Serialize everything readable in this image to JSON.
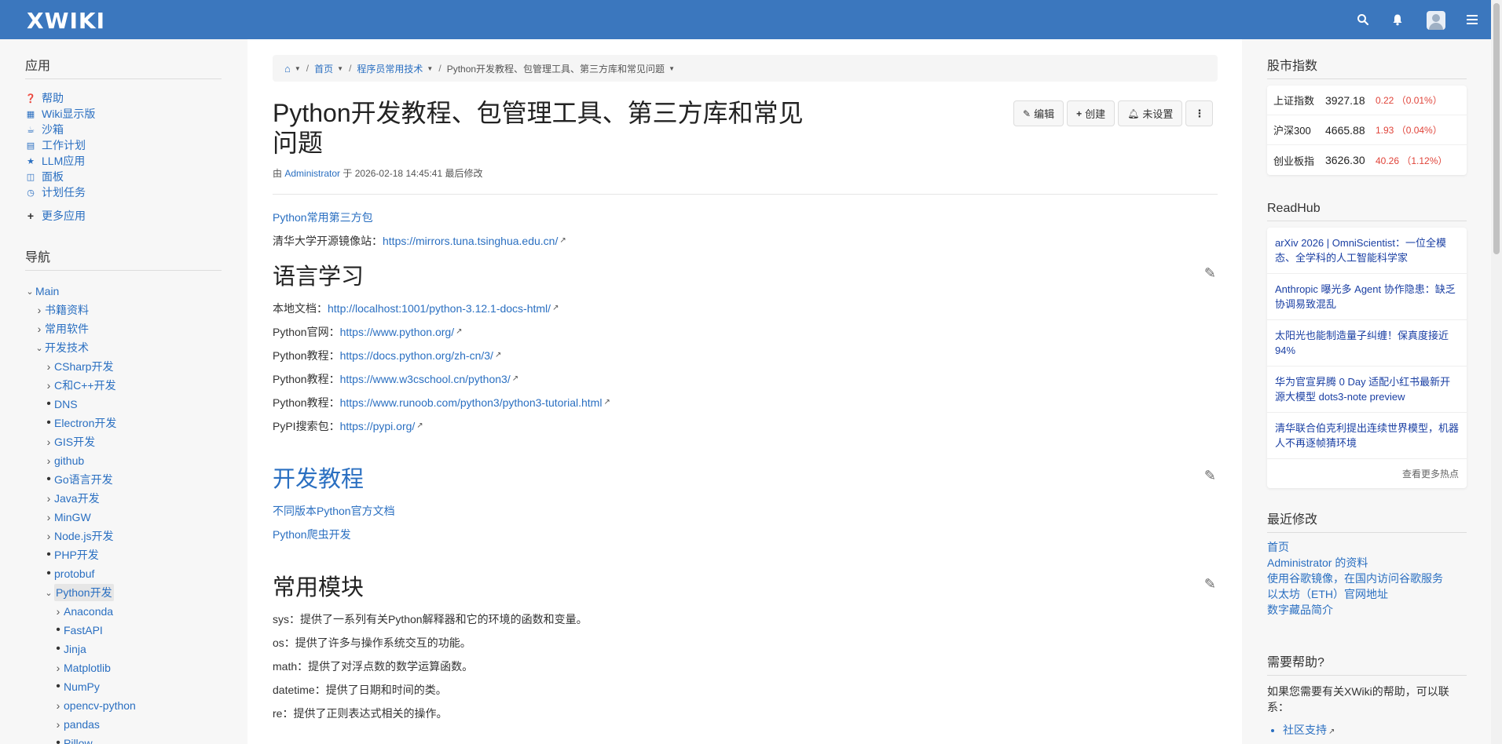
{
  "topbar": {
    "logo": "XWIKI"
  },
  "apps": {
    "title": "应用",
    "items": [
      {
        "label": "帮助",
        "icon": "question-circle-icon"
      },
      {
        "label": "Wiki显示版",
        "icon": "grid-icon"
      },
      {
        "label": "沙箱",
        "icon": "coffee-icon"
      },
      {
        "label": "工作计划",
        "icon": "calendar-icon"
      },
      {
        "label": "LLM应用",
        "icon": "star-icon"
      },
      {
        "label": "面板",
        "icon": "panel-icon"
      },
      {
        "label": "计划任务",
        "icon": "clock-icon"
      }
    ],
    "more": "更多应用"
  },
  "navigation": {
    "title": "导航",
    "items": [
      {
        "label": "Main",
        "level": 0,
        "marker": "open"
      },
      {
        "label": "书籍资料",
        "level": 1,
        "marker": "closed"
      },
      {
        "label": "常用软件",
        "level": 1,
        "marker": "closed"
      },
      {
        "label": "开发技术",
        "level": 1,
        "marker": "open"
      },
      {
        "label": "CSharp开发",
        "level": 2,
        "marker": "closed"
      },
      {
        "label": "C和C++开发",
        "level": 2,
        "marker": "closed"
      },
      {
        "label": "DNS",
        "level": 2,
        "marker": "leaf"
      },
      {
        "label": "Electron开发",
        "level": 2,
        "marker": "leaf"
      },
      {
        "label": "GIS开发",
        "level": 2,
        "marker": "closed"
      },
      {
        "label": "github",
        "level": 2,
        "marker": "closed"
      },
      {
        "label": "Go语言开发",
        "level": 2,
        "marker": "leaf"
      },
      {
        "label": "Java开发",
        "level": 2,
        "marker": "closed"
      },
      {
        "label": "MinGW",
        "level": 2,
        "marker": "closed"
      },
      {
        "label": "Node.js开发",
        "level": 2,
        "marker": "closed"
      },
      {
        "label": "PHP开发",
        "level": 2,
        "marker": "leaf"
      },
      {
        "label": "protobuf",
        "level": 2,
        "marker": "leaf"
      },
      {
        "label": "Python开发",
        "level": 2,
        "marker": "open",
        "active": true
      },
      {
        "label": "Anaconda",
        "level": 3,
        "marker": "closed"
      },
      {
        "label": "FastAPI",
        "level": 3,
        "marker": "leaf"
      },
      {
        "label": "Jinja",
        "level": 3,
        "marker": "leaf"
      },
      {
        "label": "Matplotlib",
        "level": 3,
        "marker": "closed"
      },
      {
        "label": "NumPy",
        "level": 3,
        "marker": "leaf"
      },
      {
        "label": "opencv-python",
        "level": 3,
        "marker": "closed"
      },
      {
        "label": "pandas",
        "level": 3,
        "marker": "closed"
      },
      {
        "label": "Pillow",
        "level": 3,
        "marker": "leaf"
      }
    ]
  },
  "breadcrumb": {
    "items": [
      "首页",
      "程序员常用技术",
      "Python开发教程、包管理工具、第三方库和常见问题"
    ]
  },
  "page": {
    "title": "Python开发教程、包管理工具、第三方库和常见问题",
    "meta_prefix": "由",
    "author": "Administrator",
    "meta_suffix": "于 2026-02-18 14:45:41 最后修改",
    "actions": [
      {
        "label": "编辑",
        "icon": "pencil-icon"
      },
      {
        "label": "创建",
        "icon": "plus-icon"
      },
      {
        "label": "未设置",
        "icon": "bell-icon"
      }
    ]
  },
  "content": {
    "intro_link": "Python常用第三方包",
    "mirror_label": "清华大学开源镜像站：",
    "mirror_url": "https://mirrors.tuna.tsinghua.edu.cn/",
    "sections": [
      {
        "heading": "语言学习",
        "linked": false,
        "lines": [
          {
            "label": "本地文档：",
            "url": "http://localhost:1001/python-3.12.1-docs-html/"
          },
          {
            "label": "Python官网：",
            "url": "https://www.python.org/"
          },
          {
            "label": "Python教程：",
            "url": "https://docs.python.org/zh-cn/3/"
          },
          {
            "label": "Python教程：",
            "url": "https://www.w3cschool.cn/python3/"
          },
          {
            "label": "Python教程：",
            "url": "https://www.runoob.com/python3/python3-tutorial.html"
          },
          {
            "label": "PyPI搜索包：",
            "url": "https://pypi.org/"
          }
        ]
      },
      {
        "heading": "开发教程",
        "linked": true,
        "lines": [
          {
            "label": "",
            "url": "不同版本Python官方文档"
          },
          {
            "label": "",
            "url": "Python爬虫开发"
          }
        ]
      },
      {
        "heading": "常用模块",
        "linked": false,
        "lines": [
          {
            "label": "sys：提供了一系列有关Python解释器和它的环境的函数和变量。",
            "url": ""
          },
          {
            "label": "os：提供了许多与操作系统交互的功能。",
            "url": ""
          },
          {
            "label": "math：提供了对浮点数的数学运算函数。",
            "url": ""
          },
          {
            "label": "datetime：提供了日期和时间的类。",
            "url": ""
          },
          {
            "label": "re：提供了正则表达式相关的操作。",
            "url": ""
          }
        ]
      }
    ]
  },
  "stocks": {
    "title": "股市指数",
    "rows": [
      {
        "name": "上证指数",
        "value": "3927.18",
        "change": "0.22 （0.01%）"
      },
      {
        "name": "沪深300",
        "value": "4665.88",
        "change": "1.93 （0.04%）"
      },
      {
        "name": "创业板指",
        "value": "3626.30",
        "change": "40.26 （1.12%）"
      }
    ],
    "change_color": "#e0443a"
  },
  "readhub": {
    "title": "ReadHub",
    "items": [
      "arXiv 2026 | OmniScientist：一位全模态、全学科的人工智能科学家",
      "Anthropic 曝光多 Agent 协作隐患：缺乏协调易致混乱",
      "太阳光也能制造量子纠缠！保真度接近94%",
      "华为官宣昇腾 0 Day 适配小红书最新开源大模型 dots3-note preview",
      "清华联合伯克利提出连续世界模型，机器人不再逐帧猜环境"
    ],
    "more": "查看更多热点"
  },
  "recent": {
    "title": "最近修改",
    "items": [
      "首页",
      "Administrator 的资料",
      "使用谷歌镜像，在国内访问谷歌服务",
      "以太坊（ETH）官网地址",
      "数字藏品简介"
    ]
  },
  "help": {
    "title": "需要帮助?",
    "text": "如果您需要有关XWiki的帮助，可以联系：",
    "items": [
      "社区支持"
    ]
  },
  "colors": {
    "topbar": "#3b77be",
    "link": "#2a6fc1"
  }
}
